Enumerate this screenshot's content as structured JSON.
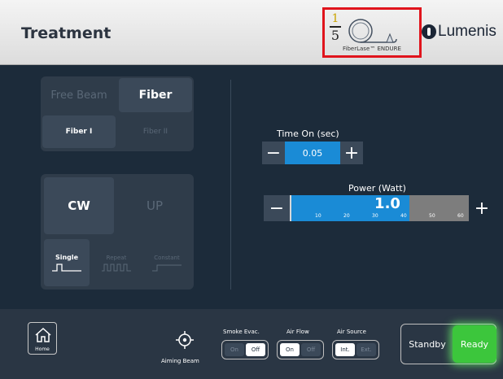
{
  "header": {
    "title": "Treatment",
    "fiber_fraction": {
      "numerator": "1",
      "denominator": "5"
    },
    "fiber_label": "FiberLase™ ENDURE",
    "logo_text": "Lumenis"
  },
  "beam_selector": {
    "free_beam": "Free Beam",
    "fiber": "Fiber",
    "selected": "Fiber"
  },
  "fiber_selector": {
    "fiber1": "Fiber I",
    "fiber2": "Fiber II",
    "selected": "Fiber I"
  },
  "mode_selector": {
    "cw": "CW",
    "up": "UP",
    "selected": "CW"
  },
  "pulse_selector": {
    "single": "Single",
    "repeat": "Repeat",
    "constant": "Constant",
    "selected": "Single"
  },
  "time_on": {
    "label": "Time On (sec)",
    "value": "0.05",
    "minus": "−",
    "plus": "+"
  },
  "power": {
    "label": "Power (Watt)",
    "value": "1.0",
    "minus": "−",
    "plus": "+",
    "ticks": [
      "10",
      "20",
      "30",
      "40",
      "50",
      "60"
    ],
    "scale_max": 60,
    "fill_fraction": 0.667
  },
  "footer": {
    "home_label": "Home",
    "aiming_beam_label": "Aiming Beam",
    "smoke_evac": {
      "label": "Smoke Evac.",
      "on": "On",
      "off": "Off",
      "selected": "Off"
    },
    "air_flow": {
      "label": "Air Flow",
      "on": "On",
      "off": "Off",
      "selected": "On"
    },
    "air_source": {
      "label": "Air Source",
      "int": "Int.",
      "ext": "Ext.",
      "selected": "Int."
    },
    "standby": "Standby",
    "ready": "Ready"
  },
  "colors": {
    "accent_blue": "#1a8bd6",
    "ready_green": "#3cc63c",
    "highlight_red": "#e0141c",
    "background": "#1c2b3a"
  },
  "icons": [
    "home-icon",
    "aiming-beam-icon",
    "fiber-coil-icon",
    "lumenis-logo-icon"
  ]
}
